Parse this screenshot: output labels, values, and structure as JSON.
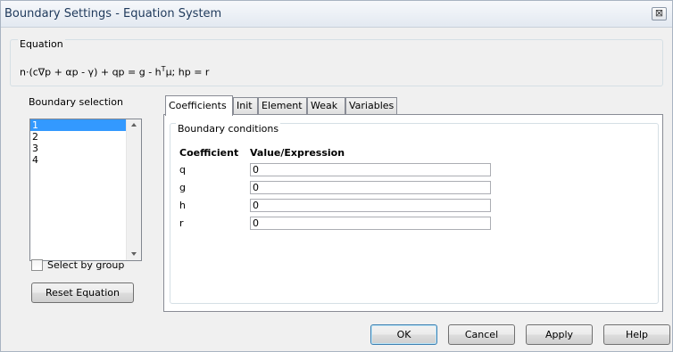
{
  "window": {
    "title": "Boundary Settings - Equation System",
    "close_symbol": "⊠"
  },
  "equation": {
    "label": "Equation",
    "text_part1": "n·(c∇p + αp - γ) + qp = g - h",
    "superscript": "T",
    "text_part2": "μ; hp = r"
  },
  "boundary_selection": {
    "label": "Boundary selection",
    "items": [
      "1",
      "2",
      "3",
      "4"
    ],
    "selected": "1",
    "select_by_group_label": "Select by group",
    "select_by_group_checked": false,
    "reset_button": "Reset Equation"
  },
  "tabs": [
    "Coefficients",
    "Init",
    "Element",
    "Weak",
    "Variables"
  ],
  "active_tab": "Coefficients",
  "boundary_conditions": {
    "label": "Boundary conditions",
    "header_coefficient": "Coefficient",
    "header_value": "Value/Expression",
    "rows": [
      {
        "name": "q",
        "value": "0"
      },
      {
        "name": "g",
        "value": "0"
      },
      {
        "name": "h",
        "value": "0"
      },
      {
        "name": "r",
        "value": "0"
      }
    ]
  },
  "buttons": {
    "ok": "OK",
    "cancel": "Cancel",
    "apply": "Apply",
    "help": "Help"
  },
  "colors": {
    "selection": "#3399ff",
    "title_text": "#1e395b"
  },
  "icons": {
    "close": "close-icon",
    "scroll_up": "scroll-up-arrow-icon",
    "scroll_down": "scroll-down-arrow-icon"
  }
}
